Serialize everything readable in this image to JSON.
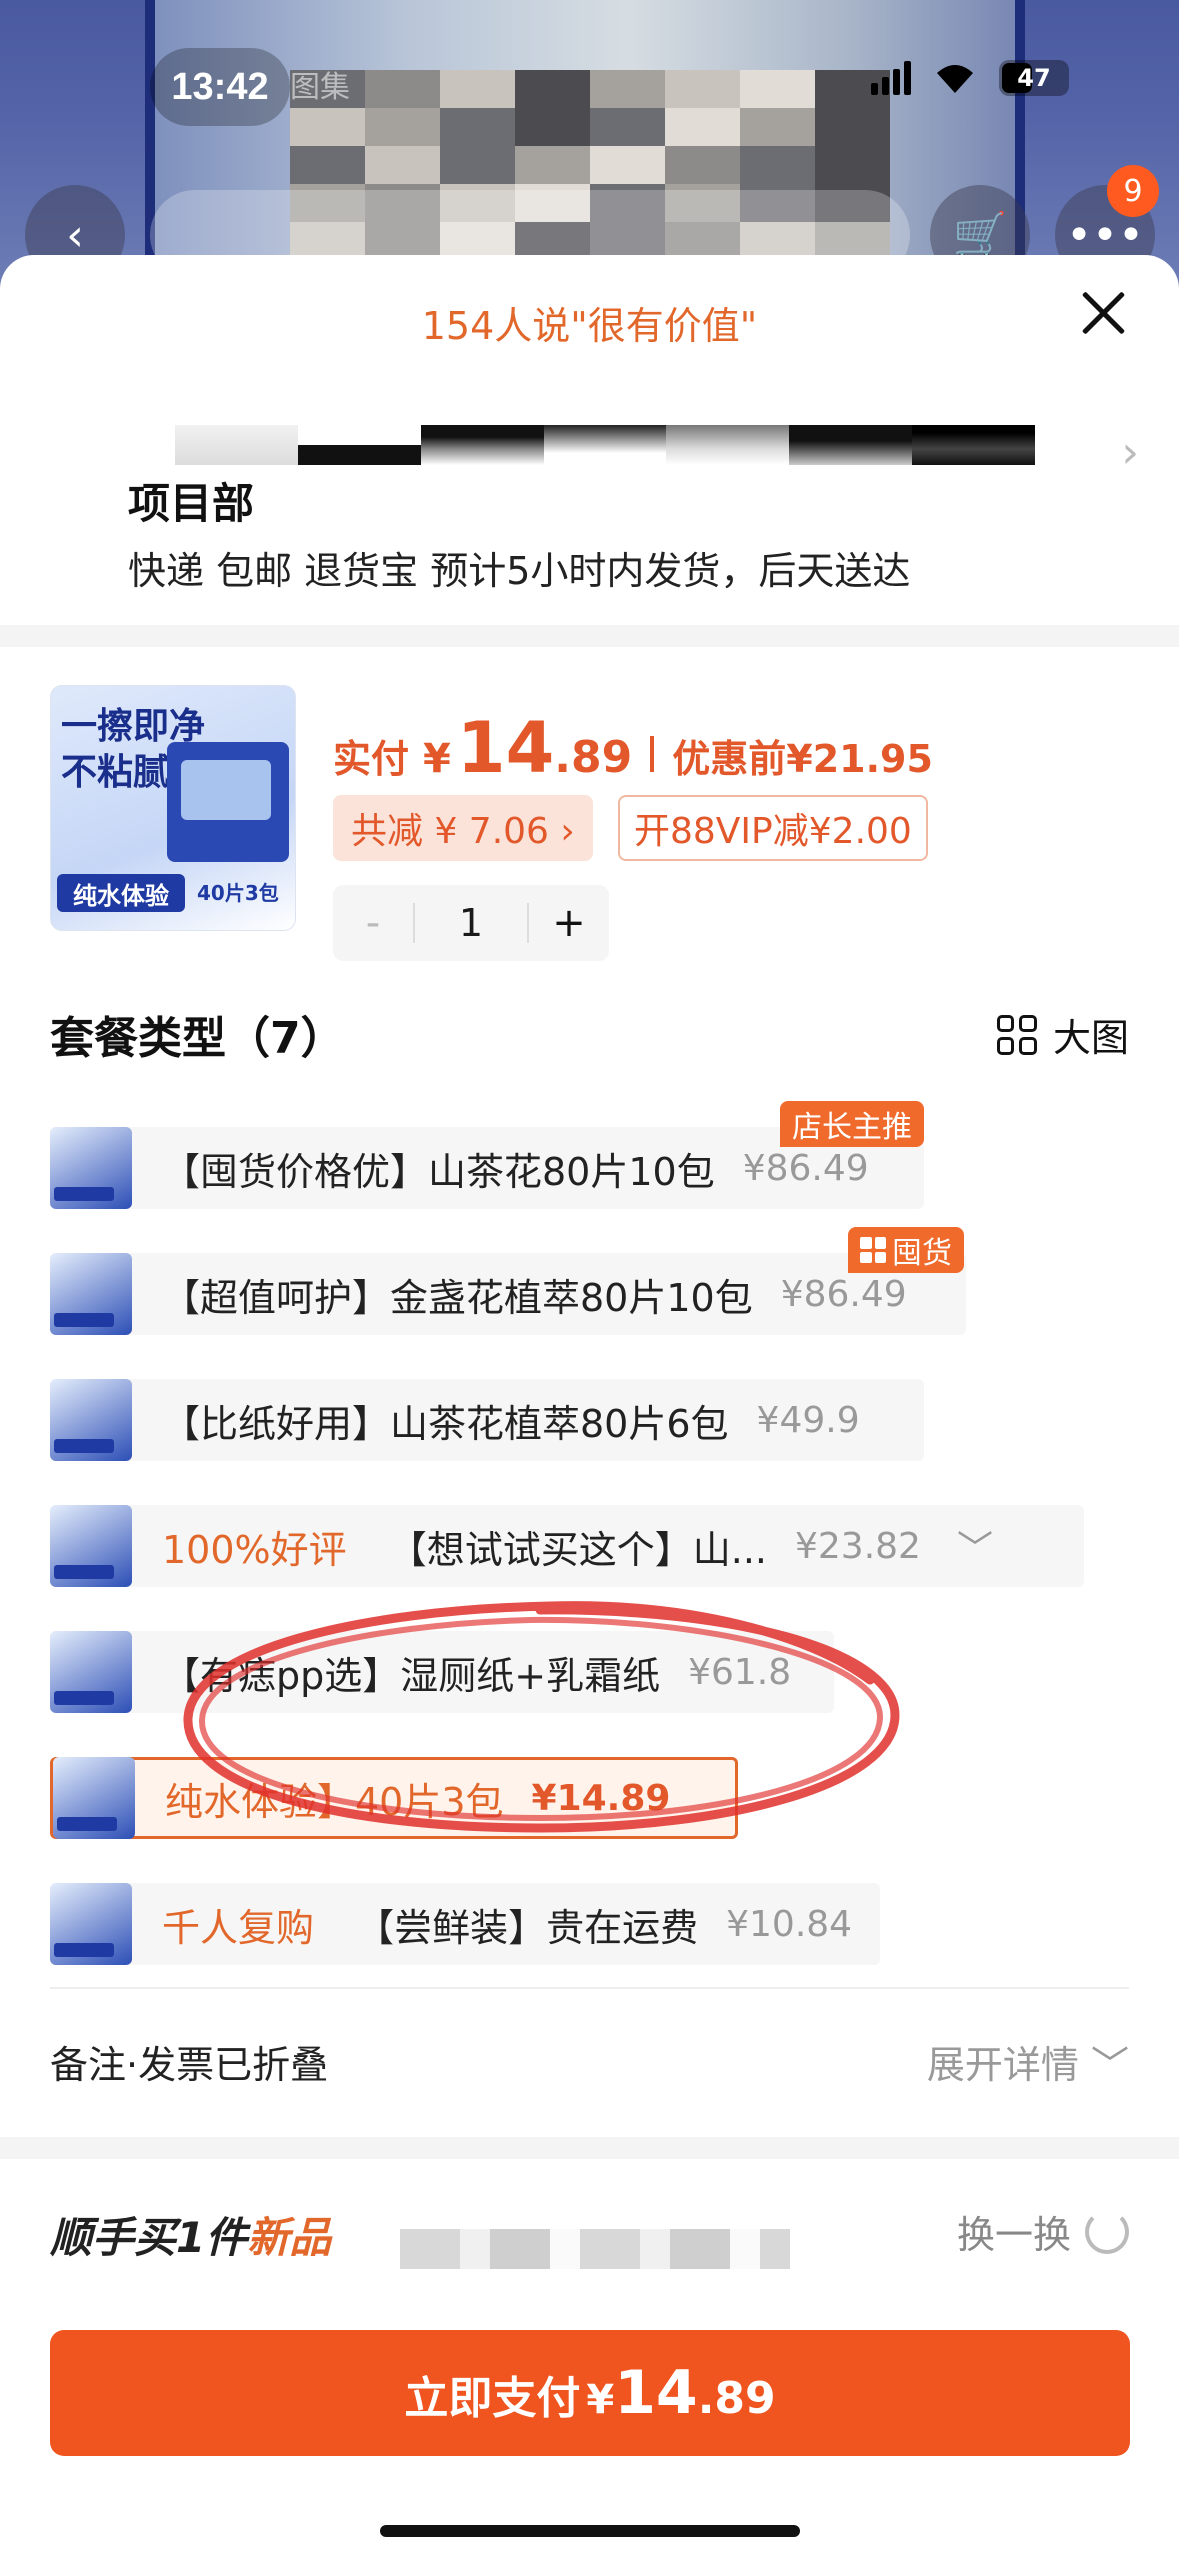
{
  "status_bar": {
    "time": "13:42",
    "battery": "47"
  },
  "background": {
    "cart_count": "9",
    "dim_label": "图集"
  },
  "sheet": {
    "praise": "154人说\"很有价值\"",
    "address": {
      "line1": "项目部",
      "line2": "快递 包邮 退货宝 预计5小时内发货，后天送达"
    },
    "summary": {
      "thumb_text_line1": "一擦即净",
      "thumb_text_line2": "不粘腻",
      "thumb_badge": "纯水体验",
      "thumb_count": "40片3包",
      "price_label": "实付",
      "currency": "¥",
      "price_int": "14",
      "price_dec": ".89",
      "orig_label": "优惠前",
      "orig_price": "¥21.95",
      "discount": "共减 ¥ 7.06 ›",
      "vip": "开88VIP减¥2.00",
      "stepper": {
        "minus": "-",
        "qty": "1",
        "plus": "+"
      }
    },
    "variant_header": {
      "title": "套餐类型（7）",
      "bigview": "大图"
    },
    "variants": [
      {
        "text": "【囤货价格优】山茶花80片10包",
        "price": "¥86.49",
        "badge": "店长主推"
      },
      {
        "text": "【超值呵护】金盏花植萃80片10包",
        "price": "¥86.49",
        "badge": "囤货"
      },
      {
        "text": "【比纸好用】山茶花植萃80片6包",
        "price": "¥49.9"
      },
      {
        "highlight": "100%好评",
        "text": "【想试试买这个】山...",
        "price": "¥23.82"
      },
      {
        "text": "【有痣pp选】湿厕纸+乳霜纸",
        "price": "¥61.8"
      },
      {
        "text": "纯水体验】40片3包",
        "price": "¥14.89",
        "selected": true
      },
      {
        "highlight": "千人复购",
        "text": "【尝鲜装】贵在运费",
        "price": "¥10.84"
      }
    ],
    "remark": {
      "label": "备注·发票已折叠",
      "expand": "展开详情 ﹀"
    },
    "addon": {
      "title_a": "顺手买1件",
      "title_b": "新品",
      "swap": "换一换"
    },
    "pay": {
      "label": "立即支付",
      "currency": "¥",
      "int": "14",
      "dec": ".89"
    }
  },
  "colors": {
    "accent": "#e2582b",
    "pay_button": "#f0541f",
    "selection_bg": "#fff3ec"
  }
}
